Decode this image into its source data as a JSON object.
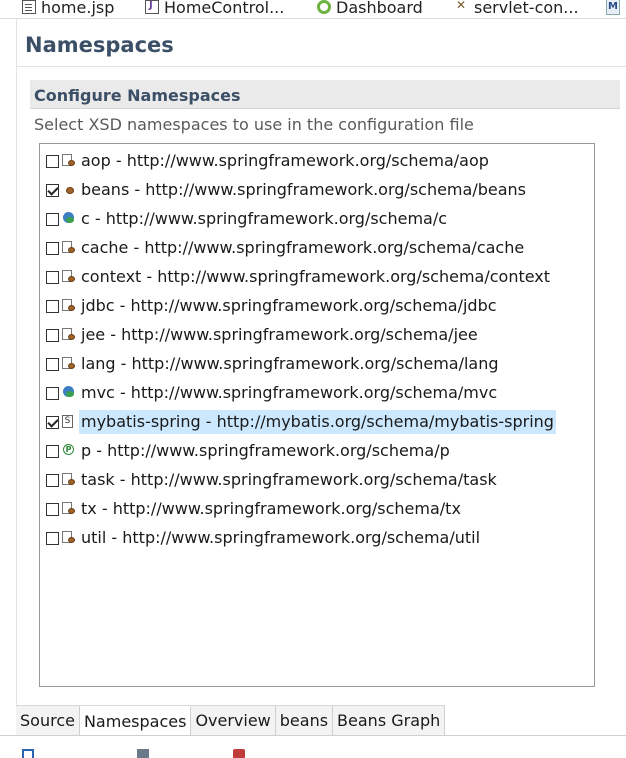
{
  "editor_tabs": [
    {
      "label": "home.jsp",
      "icon": "jsp-file-icon"
    },
    {
      "label": "HomeControl...",
      "icon": "java-file-icon"
    },
    {
      "label": "Dashboard",
      "icon": "spring-dashboard-icon"
    },
    {
      "label": "servlet-con...",
      "icon": "xml-file-icon"
    }
  ],
  "overflow_tab_icon": "M",
  "form": {
    "title": "Namespaces",
    "section_title": "Configure Namespaces",
    "section_description": "Select XSD namespaces to use in the configuration file"
  },
  "namespaces": [
    {
      "label": "aop - http://www.springframework.org/schema/aop",
      "checked": false,
      "icon": "aop-namespace-icon",
      "selected": false
    },
    {
      "label": "beans - http://www.springframework.org/schema/beans",
      "checked": true,
      "icon": "bean-icon",
      "selected": false
    },
    {
      "label": "c - http://www.springframework.org/schema/c",
      "checked": false,
      "icon": "c-namespace-icon",
      "selected": false
    },
    {
      "label": "cache - http://www.springframework.org/schema/cache",
      "checked": false,
      "icon": "cache-namespace-icon",
      "selected": false
    },
    {
      "label": "context - http://www.springframework.org/schema/context",
      "checked": false,
      "icon": "context-namespace-icon",
      "selected": false
    },
    {
      "label": "jdbc - http://www.springframework.org/schema/jdbc",
      "checked": false,
      "icon": "jdbc-namespace-icon",
      "selected": false
    },
    {
      "label": "jee - http://www.springframework.org/schema/jee",
      "checked": false,
      "icon": "jee-namespace-icon",
      "selected": false
    },
    {
      "label": "lang - http://www.springframework.org/schema/lang",
      "checked": false,
      "icon": "lang-namespace-icon",
      "selected": false
    },
    {
      "label": "mvc - http://www.springframework.org/schema/mvc",
      "checked": false,
      "icon": "mvc-namespace-icon",
      "selected": false
    },
    {
      "label": "mybatis-spring - http://mybatis.org/schema/mybatis-spring",
      "checked": true,
      "icon": "schema-file-icon",
      "selected": true
    },
    {
      "label": "p - http://www.springframework.org/schema/p",
      "checked": false,
      "icon": "p-namespace-icon",
      "selected": false
    },
    {
      "label": "task - http://www.springframework.org/schema/task",
      "checked": false,
      "icon": "task-namespace-icon",
      "selected": false
    },
    {
      "label": "tx - http://www.springframework.org/schema/tx",
      "checked": false,
      "icon": "tx-namespace-icon",
      "selected": false
    },
    {
      "label": "util - http://www.springframework.org/schema/util",
      "checked": false,
      "icon": "util-namespace-icon",
      "selected": false
    }
  ],
  "page_tabs": [
    {
      "label": "Source",
      "active": false
    },
    {
      "label": "Namespaces",
      "active": true
    },
    {
      "label": "Overview",
      "active": false
    },
    {
      "label": "beans",
      "active": false
    },
    {
      "label": "Beans Graph",
      "active": false
    }
  ],
  "colors": {
    "title": "#3b4f66",
    "selection": "#cce8ff",
    "section_header_bg": "#eaeaea"
  }
}
